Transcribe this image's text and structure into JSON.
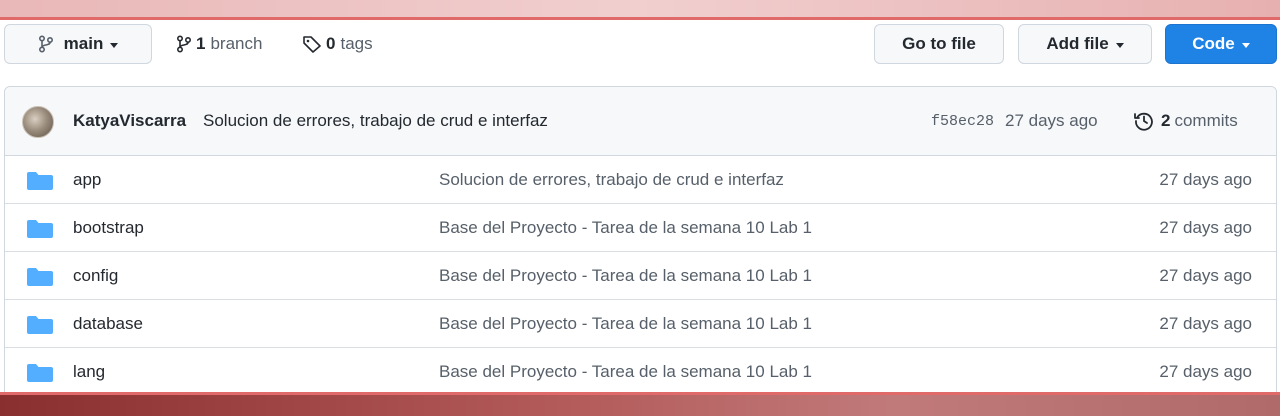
{
  "toolbar": {
    "branch_label": "main",
    "branch_count": "1",
    "branch_word": "branch",
    "tag_count": "0",
    "tag_word": "tags",
    "go_to_file_label": "Go to file",
    "add_file_label": "Add file",
    "code_label": "Code"
  },
  "latest_commit": {
    "author": "KatyaViscarra",
    "message": "Solucion de errores, trabajo de crud e interfaz",
    "sha": "f58ec28",
    "age": "27 days ago",
    "commit_count": "2",
    "commit_word": "commits"
  },
  "files": [
    {
      "name": "app",
      "message": "Solucion de errores, trabajo de crud e interfaz",
      "age": "27 days ago",
      "icon": "folder-icon"
    },
    {
      "name": "bootstrap",
      "message": "Base del Proyecto - Tarea de la semana 10 Lab 1",
      "age": "27 days ago",
      "icon": "folder-icon"
    },
    {
      "name": "config",
      "message": "Base del Proyecto - Tarea de la semana 10 Lab 1",
      "age": "27 days ago",
      "icon": "folder-icon"
    },
    {
      "name": "database",
      "message": "Base del Proyecto - Tarea de la semana 10 Lab 1",
      "age": "27 days ago",
      "icon": "folder-icon"
    },
    {
      "name": "lang",
      "message": "Base del Proyecto - Tarea de la semana 10 Lab 1",
      "age": "27 days ago",
      "icon": "folder-icon"
    }
  ],
  "colors": {
    "primary_button": "#1f83e6",
    "folder": "#54aeff",
    "frame_accent": "#e06a6a"
  }
}
